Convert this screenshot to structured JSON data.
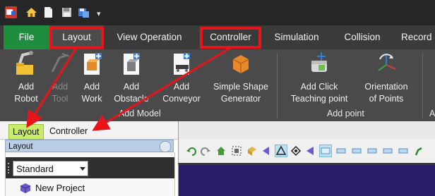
{
  "quick_access": {
    "icons": [
      "app-logo-icon",
      "home-icon",
      "new-file-icon",
      "save-icon",
      "save-as-icon"
    ],
    "dropdown_glyph": "▾"
  },
  "tabs": [
    {
      "label": "File"
    },
    {
      "label": "Layout"
    },
    {
      "label": "View Operation"
    },
    {
      "label": "Controller"
    },
    {
      "label": "Simulation"
    },
    {
      "label": "Collision"
    },
    {
      "label": "Record"
    }
  ],
  "ribbon": {
    "add_model": {
      "group_label": "Add Model",
      "buttons": [
        {
          "label1": "Add",
          "label2": "Robot",
          "icon": "robot-arm-folder-icon",
          "enabled": true
        },
        {
          "label1": "Add",
          "label2": "Tool",
          "icon": "tool-icon",
          "enabled": false
        },
        {
          "label1": "Add",
          "label2": "Work",
          "icon": "work-icon",
          "enabled": true
        },
        {
          "label1": "Add",
          "label2": "Obstacle",
          "icon": "obstacle-icon",
          "enabled": true
        },
        {
          "label1": "Add",
          "label2": "Conveyor",
          "icon": "conveyor-icon",
          "enabled": true
        },
        {
          "label1": "Simple Shape",
          "label2": "Generator",
          "icon": "shape-generator-icon",
          "enabled": true
        }
      ]
    },
    "add_point": {
      "group_label": "Add point",
      "buttons": [
        {
          "label1": "Add Click",
          "label2": "Teaching point",
          "icon": "teaching-point-icon",
          "enabled": true
        },
        {
          "label1": "Orientation",
          "label2": "of Points",
          "icon": "orientation-icon",
          "enabled": true
        }
      ]
    },
    "next_group_fragment": "A"
  },
  "left_panel": {
    "tabs": [
      {
        "label": "Layout",
        "active": true
      },
      {
        "label": "Controller",
        "active": false
      }
    ],
    "header": "Layout",
    "view_dropdown": {
      "selected": "Standard"
    },
    "tree": [
      {
        "label": "New Project",
        "icon": "project-cube-icon"
      }
    ]
  },
  "colors": {
    "file_tab": "#1e8e3e",
    "highlight": "#e8141b",
    "active_panel_tab": "#c8ec6a",
    "canvas": "#2a1b66"
  }
}
